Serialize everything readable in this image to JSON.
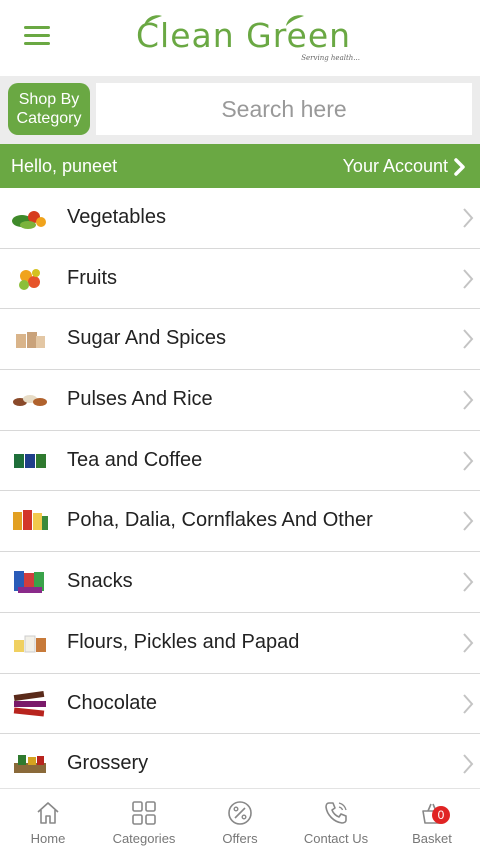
{
  "header": {
    "logo_text": "Clean  Green",
    "logo_tagline": "Serving health..."
  },
  "search": {
    "shop_by_category_line1": "Shop By",
    "shop_by_category_line2": "Category",
    "placeholder": "Search here"
  },
  "greeting": {
    "hello_text": "Hello, puneet",
    "account_text": "Your Account"
  },
  "categories": [
    {
      "label": "Vegetables",
      "icon": "vegetables-icon"
    },
    {
      "label": "Fruits",
      "icon": "fruits-icon"
    },
    {
      "label": "Sugar And Spices",
      "icon": "spices-icon"
    },
    {
      "label": "Pulses And Rice",
      "icon": "pulses-icon"
    },
    {
      "label": "Tea and Coffee",
      "icon": "tea-coffee-icon"
    },
    {
      "label": "Poha, Dalia, Cornflakes And Other",
      "icon": "cereals-icon"
    },
    {
      "label": "Snacks",
      "icon": "snacks-icon"
    },
    {
      "label": "Flours, Pickles and Papad",
      "icon": "flours-icon"
    },
    {
      "label": "Chocolate",
      "icon": "chocolate-icon"
    },
    {
      "label": "Grossery",
      "icon": "grocery-icon"
    }
  ],
  "bottom_nav": {
    "home": "Home",
    "categories": "Categories",
    "offers": "Offers",
    "contact": "Contact Us",
    "basket": "Basket",
    "basket_count": "0"
  },
  "colors": {
    "brand_green": "#6aa843",
    "badge_red": "#e02424"
  }
}
